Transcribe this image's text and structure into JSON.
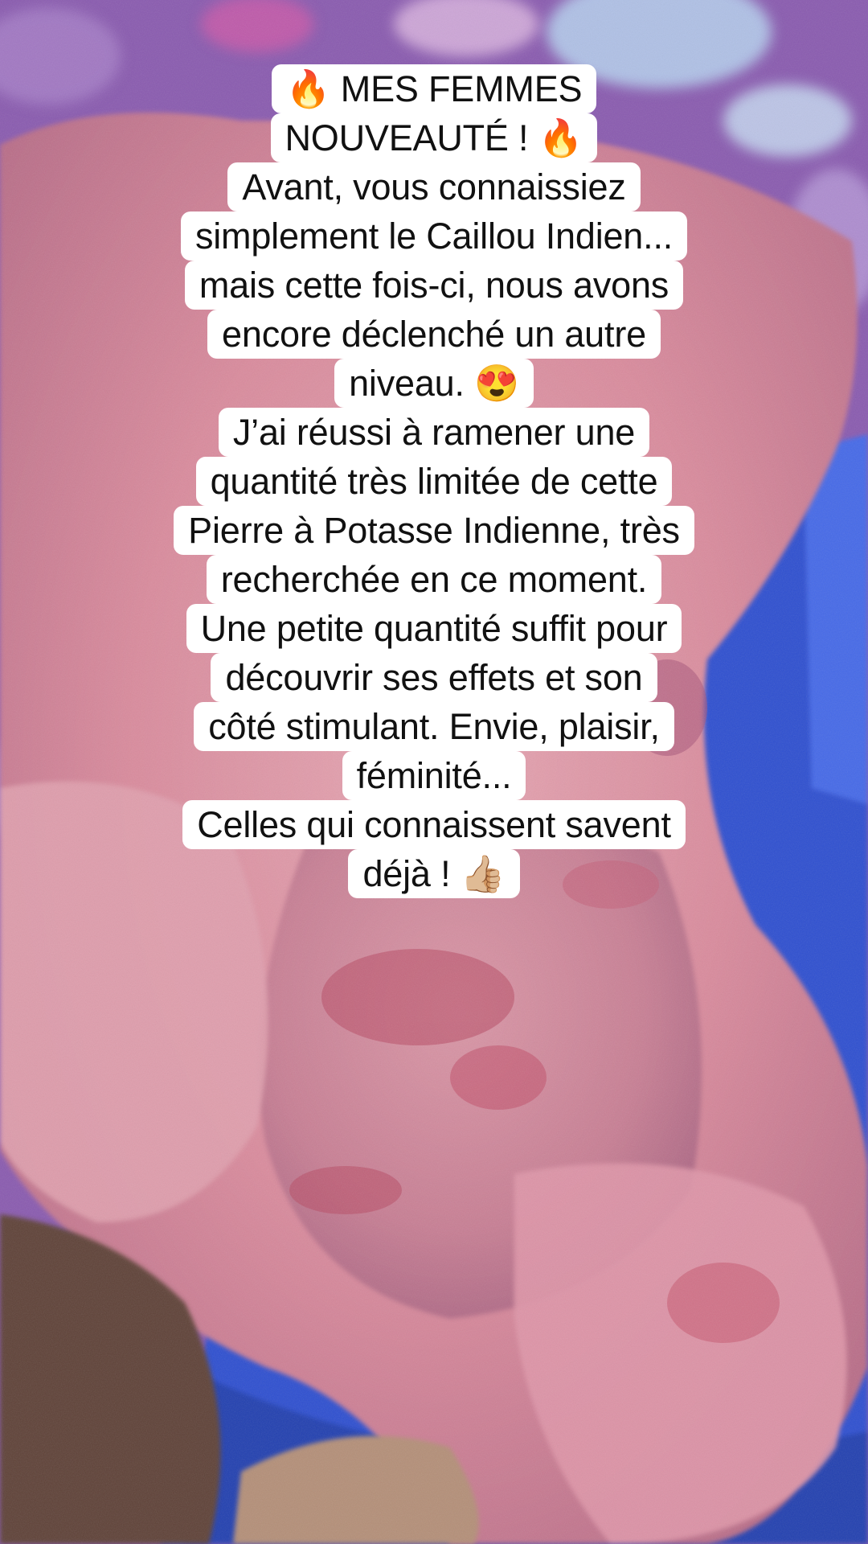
{
  "caption": {
    "lines": [
      "🔥 MES FEMMES",
      "NOUVEAUTÉ ! 🔥",
      "Avant, vous connaissiez",
      "simplement le Caillou Indien...",
      "mais cette fois-ci, nous avons",
      "encore déclenché un autre",
      "niveau. 😍",
      "J’ai réussi à ramener une",
      "quantité très limitée de cette",
      "Pierre à Potasse Indienne, très",
      "recherchée en ce moment.",
      "Une petite quantité suffit pour",
      "découvrir ses effets et son",
      "côté stimulant. Envie, plaisir,",
      "féminité...",
      "Celles qui connaissent savent",
      "déjà ! 👍🏼"
    ]
  },
  "colors": {
    "cloth": "#8a5bb0",
    "stone": "#d98a9c",
    "bowl": "#2f4fd0",
    "caption_bg": "#ffffff",
    "caption_text": "#111111"
  }
}
